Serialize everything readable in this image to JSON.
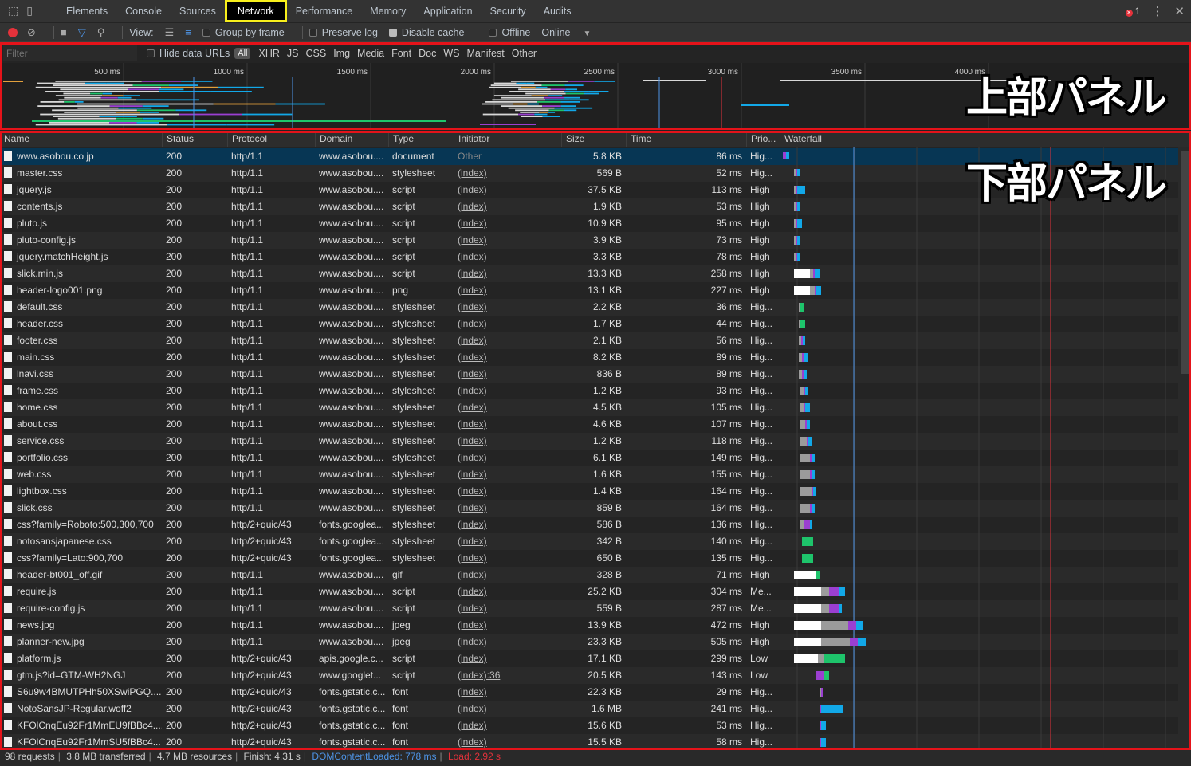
{
  "tabs": [
    "Elements",
    "Console",
    "Sources",
    "Network",
    "Performance",
    "Memory",
    "Application",
    "Security",
    "Audits"
  ],
  "active_tab": "Network",
  "error_count": "1",
  "toolbar": {
    "view_label": "View:",
    "group_by_frame": "Group by frame",
    "preserve_log": "Preserve log",
    "disable_cache": "Disable cache",
    "offline": "Offline",
    "throttle": "Online"
  },
  "filter": {
    "placeholder": "Filter",
    "hide_data_urls": "Hide data URLs",
    "all": "All",
    "types": [
      "XHR",
      "JS",
      "CSS",
      "Img",
      "Media",
      "Font",
      "Doc",
      "WS",
      "Manifest",
      "Other"
    ]
  },
  "overview": {
    "ticks": [
      "500 ms",
      "1000 ms",
      "1500 ms",
      "2000 ms",
      "2500 ms",
      "3000 ms",
      "3500 ms",
      "4000 ms"
    ],
    "label": "上部パネル"
  },
  "lower_label": "下部パネル",
  "columns": [
    "Name",
    "Status",
    "Protocol",
    "Domain",
    "Type",
    "Initiator",
    "Size",
    "Time",
    "Prio...",
    "Waterfall"
  ],
  "rows": [
    {
      "name": "www.asobou.co.jp",
      "status": "200",
      "protocol": "http/1.1",
      "domain": "www.asobou....",
      "type": "document",
      "initiator": "Other",
      "size": "5.8 KB",
      "time": "86 ms",
      "priority": "Hig..."
    },
    {
      "name": "master.css",
      "status": "200",
      "protocol": "http/1.1",
      "domain": "www.asobou....",
      "type": "stylesheet",
      "initiator": "(index)",
      "size": "569 B",
      "time": "52 ms",
      "priority": "Hig..."
    },
    {
      "name": "jquery.js",
      "status": "200",
      "protocol": "http/1.1",
      "domain": "www.asobou....",
      "type": "script",
      "initiator": "(index)",
      "size": "37.5 KB",
      "time": "113 ms",
      "priority": "High"
    },
    {
      "name": "contents.js",
      "status": "200",
      "protocol": "http/1.1",
      "domain": "www.asobou....",
      "type": "script",
      "initiator": "(index)",
      "size": "1.9 KB",
      "time": "53 ms",
      "priority": "High"
    },
    {
      "name": "pluto.js",
      "status": "200",
      "protocol": "http/1.1",
      "domain": "www.asobou....",
      "type": "script",
      "initiator": "(index)",
      "size": "10.9 KB",
      "time": "95 ms",
      "priority": "High"
    },
    {
      "name": "pluto-config.js",
      "status": "200",
      "protocol": "http/1.1",
      "domain": "www.asobou....",
      "type": "script",
      "initiator": "(index)",
      "size": "3.9 KB",
      "time": "73 ms",
      "priority": "High"
    },
    {
      "name": "jquery.matchHeight.js",
      "status": "200",
      "protocol": "http/1.1",
      "domain": "www.asobou....",
      "type": "script",
      "initiator": "(index)",
      "size": "3.3 KB",
      "time": "78 ms",
      "priority": "High"
    },
    {
      "name": "slick.min.js",
      "status": "200",
      "protocol": "http/1.1",
      "domain": "www.asobou....",
      "type": "script",
      "initiator": "(index)",
      "size": "13.3 KB",
      "time": "258 ms",
      "priority": "High"
    },
    {
      "name": "header-logo001.png",
      "status": "200",
      "protocol": "http/1.1",
      "domain": "www.asobou....",
      "type": "png",
      "initiator": "(index)",
      "size": "13.1 KB",
      "time": "227 ms",
      "priority": "High"
    },
    {
      "name": "default.css",
      "status": "200",
      "protocol": "http/1.1",
      "domain": "www.asobou....",
      "type": "stylesheet",
      "initiator": "(index)",
      "size": "2.2 KB",
      "time": "36 ms",
      "priority": "Hig..."
    },
    {
      "name": "header.css",
      "status": "200",
      "protocol": "http/1.1",
      "domain": "www.asobou....",
      "type": "stylesheet",
      "initiator": "(index)",
      "size": "1.7 KB",
      "time": "44 ms",
      "priority": "Hig..."
    },
    {
      "name": "footer.css",
      "status": "200",
      "protocol": "http/1.1",
      "domain": "www.asobou....",
      "type": "stylesheet",
      "initiator": "(index)",
      "size": "2.1 KB",
      "time": "56 ms",
      "priority": "Hig..."
    },
    {
      "name": "main.css",
      "status": "200",
      "protocol": "http/1.1",
      "domain": "www.asobou....",
      "type": "stylesheet",
      "initiator": "(index)",
      "size": "8.2 KB",
      "time": "89 ms",
      "priority": "Hig..."
    },
    {
      "name": "lnavi.css",
      "status": "200",
      "protocol": "http/1.1",
      "domain": "www.asobou....",
      "type": "stylesheet",
      "initiator": "(index)",
      "size": "836 B",
      "time": "89 ms",
      "priority": "Hig..."
    },
    {
      "name": "frame.css",
      "status": "200",
      "protocol": "http/1.1",
      "domain": "www.asobou....",
      "type": "stylesheet",
      "initiator": "(index)",
      "size": "1.2 KB",
      "time": "93 ms",
      "priority": "Hig..."
    },
    {
      "name": "home.css",
      "status": "200",
      "protocol": "http/1.1",
      "domain": "www.asobou....",
      "type": "stylesheet",
      "initiator": "(index)",
      "size": "4.5 KB",
      "time": "105 ms",
      "priority": "Hig..."
    },
    {
      "name": "about.css",
      "status": "200",
      "protocol": "http/1.1",
      "domain": "www.asobou....",
      "type": "stylesheet",
      "initiator": "(index)",
      "size": "4.6 KB",
      "time": "107 ms",
      "priority": "Hig..."
    },
    {
      "name": "service.css",
      "status": "200",
      "protocol": "http/1.1",
      "domain": "www.asobou....",
      "type": "stylesheet",
      "initiator": "(index)",
      "size": "1.2 KB",
      "time": "118 ms",
      "priority": "Hig..."
    },
    {
      "name": "portfolio.css",
      "status": "200",
      "protocol": "http/1.1",
      "domain": "www.asobou....",
      "type": "stylesheet",
      "initiator": "(index)",
      "size": "6.1 KB",
      "time": "149 ms",
      "priority": "Hig..."
    },
    {
      "name": "web.css",
      "status": "200",
      "protocol": "http/1.1",
      "domain": "www.asobou....",
      "type": "stylesheet",
      "initiator": "(index)",
      "size": "1.6 KB",
      "time": "155 ms",
      "priority": "Hig..."
    },
    {
      "name": "lightbox.css",
      "status": "200",
      "protocol": "http/1.1",
      "domain": "www.asobou....",
      "type": "stylesheet",
      "initiator": "(index)",
      "size": "1.4 KB",
      "time": "164 ms",
      "priority": "Hig..."
    },
    {
      "name": "slick.css",
      "status": "200",
      "protocol": "http/1.1",
      "domain": "www.asobou....",
      "type": "stylesheet",
      "initiator": "(index)",
      "size": "859 B",
      "time": "164 ms",
      "priority": "Hig..."
    },
    {
      "name": "css?family=Roboto:500,300,700",
      "status": "200",
      "protocol": "http/2+quic/43",
      "domain": "fonts.googlea...",
      "type": "stylesheet",
      "initiator": "(index)",
      "size": "586 B",
      "time": "136 ms",
      "priority": "Hig..."
    },
    {
      "name": "notosansjapanese.css",
      "status": "200",
      "protocol": "http/2+quic/43",
      "domain": "fonts.googlea...",
      "type": "stylesheet",
      "initiator": "(index)",
      "size": "342 B",
      "time": "140 ms",
      "priority": "Hig..."
    },
    {
      "name": "css?family=Lato:900,700",
      "status": "200",
      "protocol": "http/2+quic/43",
      "domain": "fonts.googlea...",
      "type": "stylesheet",
      "initiator": "(index)",
      "size": "650 B",
      "time": "135 ms",
      "priority": "Hig..."
    },
    {
      "name": "header-bt001_off.gif",
      "status": "200",
      "protocol": "http/1.1",
      "domain": "www.asobou....",
      "type": "gif",
      "initiator": "(index)",
      "size": "328 B",
      "time": "71 ms",
      "priority": "High"
    },
    {
      "name": "require.js",
      "status": "200",
      "protocol": "http/1.1",
      "domain": "www.asobou....",
      "type": "script",
      "initiator": "(index)",
      "size": "25.2 KB",
      "time": "304 ms",
      "priority": "Me..."
    },
    {
      "name": "require-config.js",
      "status": "200",
      "protocol": "http/1.1",
      "domain": "www.asobou....",
      "type": "script",
      "initiator": "(index)",
      "size": "559 B",
      "time": "287 ms",
      "priority": "Me..."
    },
    {
      "name": "news.jpg",
      "status": "200",
      "protocol": "http/1.1",
      "domain": "www.asobou....",
      "type": "jpeg",
      "initiator": "(index)",
      "size": "13.9 KB",
      "time": "472 ms",
      "priority": "High"
    },
    {
      "name": "planner-new.jpg",
      "status": "200",
      "protocol": "http/1.1",
      "domain": "www.asobou....",
      "type": "jpeg",
      "initiator": "(index)",
      "size": "23.3 KB",
      "time": "505 ms",
      "priority": "High"
    },
    {
      "name": "platform.js",
      "status": "200",
      "protocol": "http/2+quic/43",
      "domain": "apis.google.c...",
      "type": "script",
      "initiator": "(index)",
      "size": "17.1 KB",
      "time": "299 ms",
      "priority": "Low"
    },
    {
      "name": "gtm.js?id=GTM-WH2NGJ",
      "status": "200",
      "protocol": "http/2+quic/43",
      "domain": "www.googlet...",
      "type": "script",
      "initiator": "(index):36",
      "size": "20.5 KB",
      "time": "143 ms",
      "priority": "Low"
    },
    {
      "name": "S6u9w4BMUTPHh50XSwiPGQ....",
      "status": "200",
      "protocol": "http/2+quic/43",
      "domain": "fonts.gstatic.c...",
      "type": "font",
      "initiator": "(index)",
      "size": "22.3 KB",
      "time": "29 ms",
      "priority": "Hig..."
    },
    {
      "name": "NotoSansJP-Regular.woff2",
      "status": "200",
      "protocol": "http/2+quic/43",
      "domain": "fonts.gstatic.c...",
      "type": "font",
      "initiator": "(index)",
      "size": "1.6 MB",
      "time": "241 ms",
      "priority": "Hig..."
    },
    {
      "name": "KFOlCnqEu92Fr1MmEU9fBBc4....",
      "status": "200",
      "protocol": "http/2+quic/43",
      "domain": "fonts.gstatic.c...",
      "type": "font",
      "initiator": "(index)",
      "size": "15.6 KB",
      "time": "53 ms",
      "priority": "Hig..."
    },
    {
      "name": "KFOlCnqEu92Fr1MmSU5fBBc4...",
      "status": "200",
      "protocol": "http/2+quic/43",
      "domain": "fonts.gstatic.c...",
      "type": "font",
      "initiator": "(index)",
      "size": "15.5 KB",
      "time": "58 ms",
      "priority": "Hig..."
    }
  ],
  "status": {
    "requests": "98 requests",
    "transferred": "3.8 MB transferred",
    "resources": "4.7 MB resources",
    "finish": "Finish: 4.31 s",
    "dcl": "DOMContentLoaded: 778 ms",
    "load": "Load: 2.92 s"
  },
  "colors": {
    "selected_row": "#073654",
    "dcl_line": "#4e94e6",
    "load_line": "#e5323b",
    "active_tab_outline": "#f8ef1c",
    "annotation_box": "#e5131a"
  }
}
